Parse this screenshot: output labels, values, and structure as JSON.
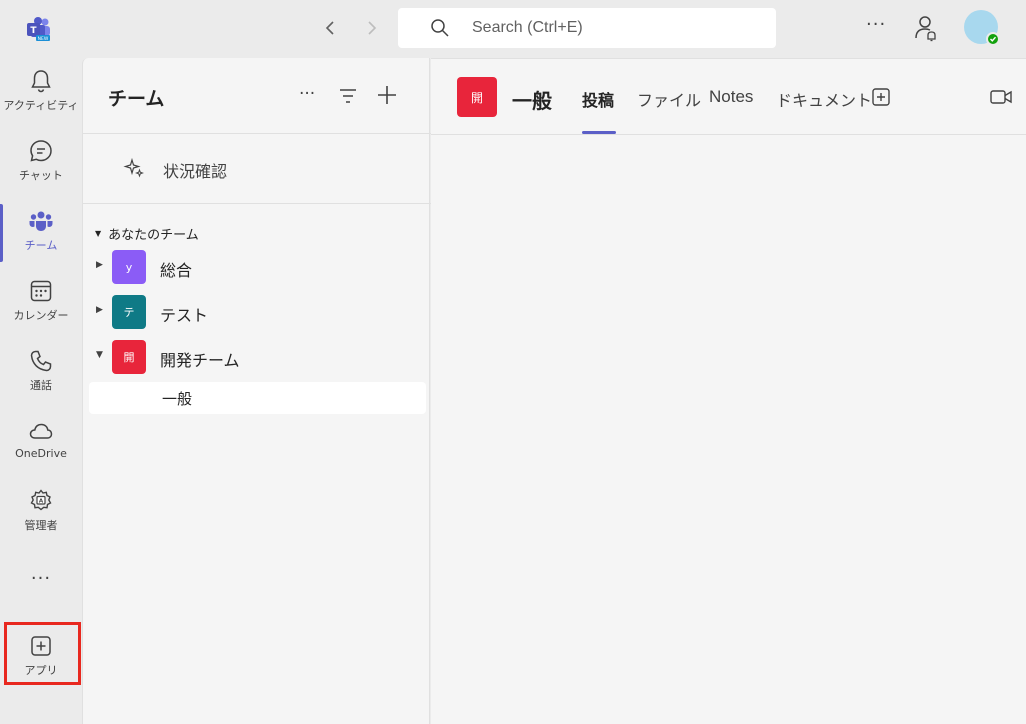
{
  "titlebar": {
    "search_placeholder": "Search (Ctrl+E)",
    "more": "···"
  },
  "rail": {
    "items": [
      {
        "label": "アクティビティ",
        "icon": "bell-icon"
      },
      {
        "label": "チャット",
        "icon": "chat-icon"
      },
      {
        "label": "チーム",
        "icon": "teams-icon"
      },
      {
        "label": "カレンダー",
        "icon": "calendar-icon"
      },
      {
        "label": "通話",
        "icon": "phone-icon"
      },
      {
        "label": "OneDrive",
        "icon": "cloud-icon"
      },
      {
        "label": "管理者",
        "icon": "admin-gear-icon"
      },
      {
        "label": "アプリ",
        "icon": "add-app-icon"
      }
    ],
    "more": "···",
    "active_color": "#5b5fc7"
  },
  "teams_panel": {
    "title": "チーム",
    "more": "···",
    "status_label": "状況確認",
    "section_label": "あなたのチーム",
    "teams": [
      {
        "initial": "y",
        "name": "総合",
        "color": "#8b5cf6",
        "expanded": false
      },
      {
        "initial": "テ",
        "name": "テスト",
        "color": "#0f7a86",
        "expanded": false
      },
      {
        "initial": "開",
        "name": "開発チーム",
        "color": "#e8253b",
        "expanded": true
      }
    ],
    "channels": [
      {
        "name": "一般"
      }
    ]
  },
  "main": {
    "channel_initial": "開",
    "channel_name": "一般",
    "tabs": [
      {
        "label": "投稿",
        "active": true
      },
      {
        "label": "ファイル",
        "active": false
      },
      {
        "label": "Notes",
        "active": false
      },
      {
        "label": "ドキュメント",
        "active": false
      }
    ]
  }
}
